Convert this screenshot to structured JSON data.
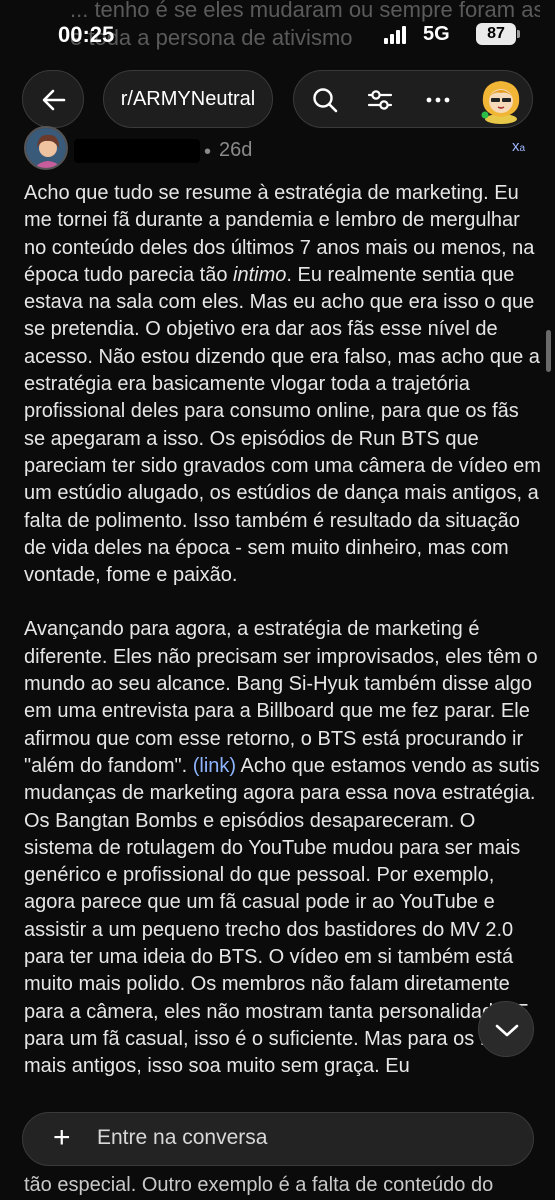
{
  "ghost": {
    "line1": "... tenho é se eles mudaram ou sempre foram assim",
    "line2": "e toda a persona de ativismo"
  },
  "status": {
    "time": "00:25",
    "network": "5G",
    "battery": "87"
  },
  "nav": {
    "subreddit": "r/ARMYNeutral"
  },
  "comment": {
    "age": "26d",
    "dot": "•",
    "translate_glyph": "x",
    "p1": "Acho que tudo se resume à estratégia de marketing. Eu me tornei fã durante a pandemia e lembro de mergulhar no conteúdo deles dos últimos 7 anos mais ou menos, na época tudo parecia tão ",
    "p1_em": "intimo",
    "p1_rest": ". Eu realmente sentia que estava na sala com eles. Mas eu acho que era isso o que se pretendia. O objetivo era dar aos fãs esse nível de acesso. Não estou dizendo que era falso, mas acho que a estratégia era basicamente vlogar toda a trajetória profissional deles para consumo online, para que os fãs se apegaram a isso. Os episódios de Run BTS que pareciam ter sido gravados com uma câmera de vídeo em um estúdio alugado, os estúdios de dança mais antigos, a falta de polimento. Isso também é resultado da situação de vida deles na época - sem muito dinheiro, mas com vontade, fome e paixão.",
    "p2": "Avançando para agora, a estratégia de marketing é diferente. Eles não precisam ser improvisados, eles têm o mundo ao seu alcance. Bang Si-Hyuk também disse algo em uma entrevista para a Billboard que me fez parar. Ele afirmou que com esse retorno, o BTS está procurando ir \"além do fandom\". ",
    "p2_link": "(link)",
    "p2_rest": " Acho que estamos vendo as sutis mudanças de marketing agora para essa nova estratégia. Os Bangtan Bombs e episódios desapareceram. O sistema de rotulagem do YouTube mudou para ser mais genérico e profissional do que pessoal. Por exemplo, agora parece que um fã casual pode ir ao YouTube e assistir a um pequeno trecho dos bastidores do MV 2.0 para ter uma ideia do BTS. O vídeo em si também está muito mais polido. Os membros não falam diretamente para a câmera, eles não mostram tanta personalidade. E para um fã casual, isso é o suficiente. Mas para os fãs mais antigos, isso soa muito sem graça. Eu"
  },
  "composer": {
    "plus": "+",
    "placeholder": "Entre na conversa"
  },
  "footer": {
    "text": "tão especial. Outro exemplo é a falta de conteúdo do"
  },
  "colors": {
    "link": "#8fb4ff",
    "translate": "#9fb7ff",
    "background": "#0b0b0b"
  }
}
